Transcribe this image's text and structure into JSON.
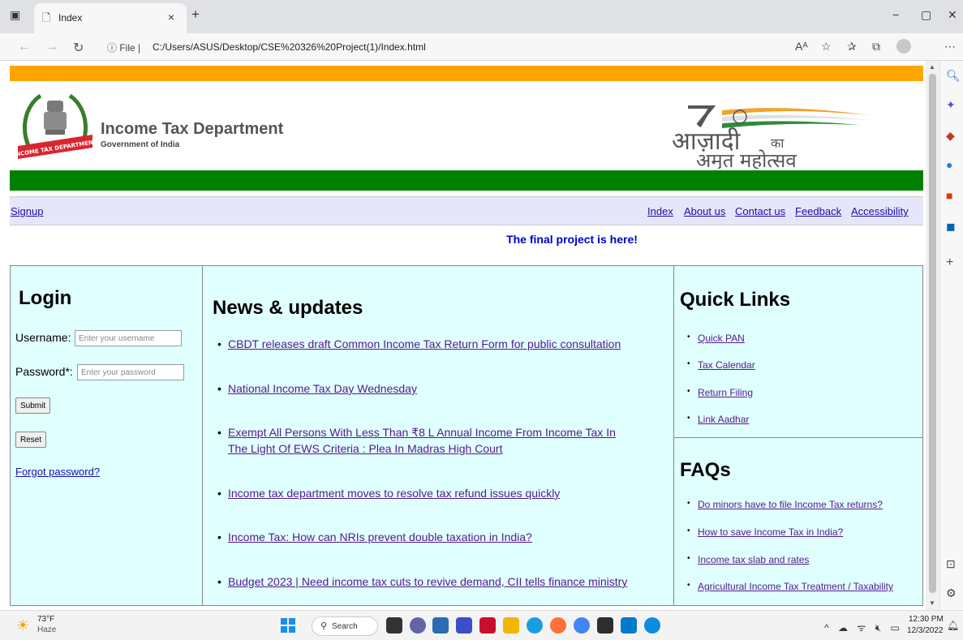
{
  "browser": {
    "tab_title": "Index",
    "tab_close": "×",
    "new_tab": "+",
    "url_info": "ⓘ File |",
    "url": "C:/Users/ASUS/Desktop/CSE%20326%20Project(1)/Index.html",
    "window_controls": [
      "−",
      "▢",
      "✕"
    ]
  },
  "header": {
    "title": "Income Tax Department",
    "subtitle": "Government of India",
    "emblem_ribbon_text": "INCOME TAX DEPARTMENT",
    "azadi_line1": "आज़ादी",
    "azadi_ka": "का",
    "azadi_line2": "अमृत महोत्सव"
  },
  "nav": {
    "signup": "Signup",
    "links": [
      "Index",
      "About us",
      "Contact us",
      "Feedback",
      "Accessibility"
    ]
  },
  "tagline": "The final project is here!",
  "login": {
    "title": "Login",
    "username_label": "Username:",
    "username_placeholder": "Enter your username",
    "password_label": "Password*:",
    "password_placeholder": "Enter your password",
    "submit_label": "Submit",
    "reset_label": "Reset",
    "forgot_label": "Forgot password?"
  },
  "news": {
    "title": "News & updates",
    "items": [
      "CBDT releases draft Common Income Tax Return Form for public consultation",
      "National Income Tax Day Wednesday",
      "Exempt All Persons With Less Than ₹8 L Annual Income From Income Tax In The Light Of EWS Criteria : Plea In Madras High Court",
      "Income tax department moves to resolve tax refund issues quickly",
      "Income Tax: How can NRIs prevent double taxation in India?",
      "Budget 2023 | Need income tax cuts to revive demand, CII tells finance ministry"
    ]
  },
  "quick_links": {
    "title": "Quick Links",
    "items": [
      "Quick PAN",
      "Tax Calendar",
      "Return Filing",
      "Link Aadhar"
    ]
  },
  "faqs": {
    "title": "FAQs",
    "items": [
      "Do minors have to file Income Tax returns?",
      "How to save Income Tax in India?",
      "Income tax slab and rates",
      "Agricultural Income Tax Treatment / Taxability"
    ]
  },
  "taskbar": {
    "temperature": "73°F",
    "condition": "Haze",
    "search_label": "Search",
    "time": "12:30 PM",
    "date": "12/3/2022"
  },
  "colors": {
    "saffron_bar": "#ffa500",
    "green_bar": "#008000",
    "nav_bg": "#e6e6fa",
    "panel_bg": "#e0ffff",
    "tagline": "#0000cc"
  }
}
